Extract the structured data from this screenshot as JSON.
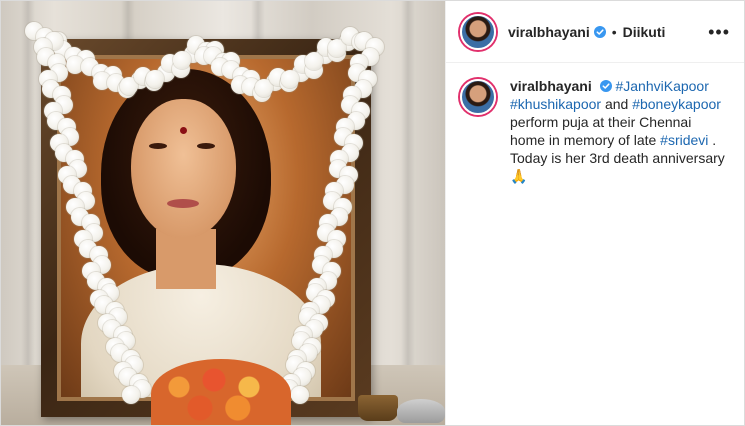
{
  "post": {
    "username": "viralbhayani",
    "follow_label": "Diikuti",
    "separator": "•",
    "more_icon": "•••",
    "caption": {
      "username": "viralbhayani",
      "hashtag_1": "#JanhviKapoor",
      "hashtag_2": "#khushikapoor",
      "text_and": " and ",
      "hashtag_3": "#boneykapoor",
      "text_1": " perform puja at their Chennai home in memory of late ",
      "hashtag_4": "#sridevi",
      "text_2": " . Today is her 3rd death anniversary ",
      "emoji": "🙏"
    }
  },
  "colors": {
    "verified_blue": "#3897f0",
    "hashtag_blue": "#1c67b0",
    "story_ring": "#e1306c"
  },
  "icons": {
    "verified": "verified-badge-icon",
    "more": "more-options-icon"
  }
}
